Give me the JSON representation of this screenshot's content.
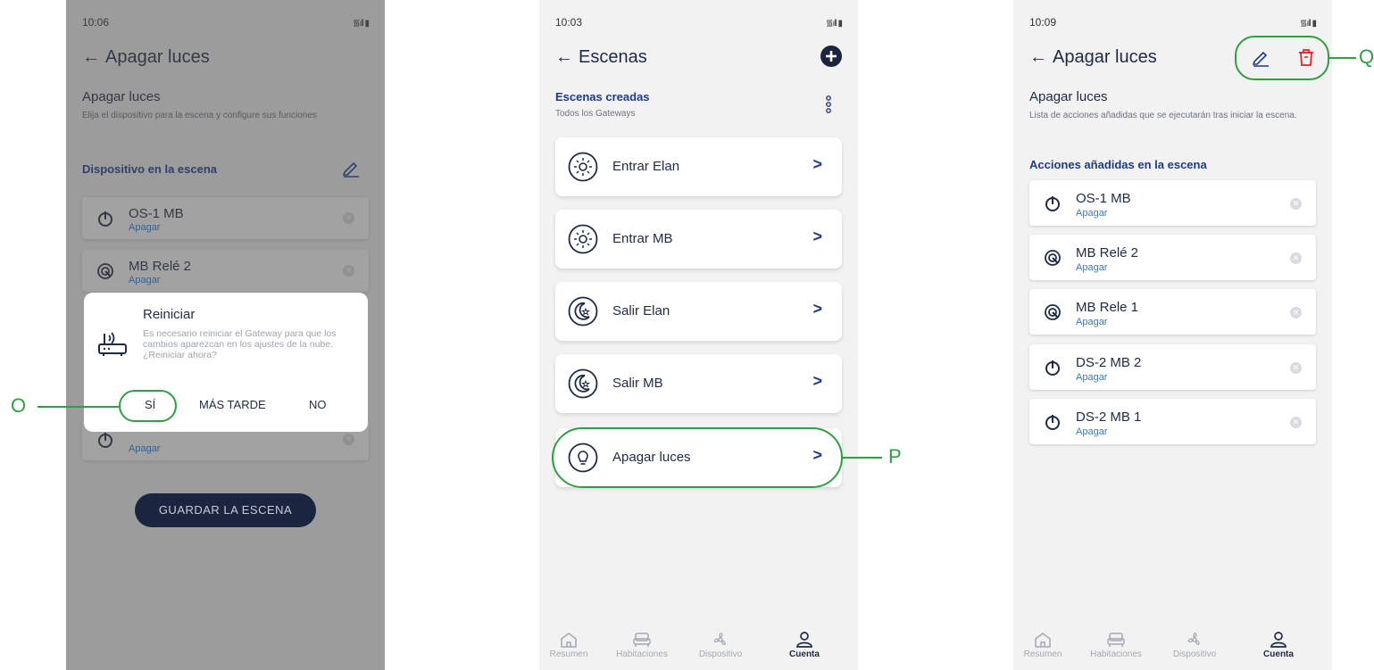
{
  "screen1": {
    "time": "10:06",
    "title": "Apagar luces",
    "section_title": "Apagar luces",
    "section_sub": "Elija el dispositivo para la escena y configure sus funciones",
    "devices_header": "Dispositivo en la escena",
    "devices": [
      {
        "name": "OS-1 MB",
        "action": "Apagar"
      },
      {
        "name": "MB Relé 2",
        "action": "Apagar"
      },
      {
        "name": "",
        "action": "Apagar"
      }
    ],
    "dialog": {
      "title": "Reiniciar",
      "body_1": "Es necesario reiniciar el Gateway para que los cambios aparezcan en los ajustes de la nube.",
      "body_2": "¿Reiniciar ahora?",
      "yes": "SÍ",
      "later": "MÁS TARDE",
      "no": "NO"
    },
    "save_button": "GUARDAR LA ESCENA"
  },
  "screen2": {
    "time": "10:03",
    "title": "Escenas",
    "section_title": "Escenas creadas",
    "section_sub": "Todos los Gateways",
    "scenes": [
      {
        "name": "Entrar Elan",
        "icon": "sun-icon"
      },
      {
        "name": "Entrar MB",
        "icon": "sun-icon"
      },
      {
        "name": "Salir Elan",
        "icon": "moon-star-icon"
      },
      {
        "name": "Salir MB",
        "icon": "moon-star-icon"
      },
      {
        "name": "Apagar luces",
        "icon": "bulb-icon"
      }
    ]
  },
  "screen3": {
    "time": "10:09",
    "title": "Apagar luces",
    "section_title": "Apagar luces",
    "section_sub": "Lista de acciones añadidas que se ejecutarán tras iniciar la escena.",
    "actions_header": "Acciones añadidas en la escena",
    "actions": [
      {
        "name": "OS-1 MB",
        "action": "Apagar",
        "icon": "power-icon"
      },
      {
        "name": "MB Relé 2",
        "action": "Apagar",
        "icon": "relay-icon"
      },
      {
        "name": "MB Rele 1",
        "action": "Apagar",
        "icon": "relay-icon"
      },
      {
        "name": "DS-2 MB 2",
        "action": "Apagar",
        "icon": "power-icon"
      },
      {
        "name": "DS-2 MB 1",
        "action": "Apagar",
        "icon": "power-icon"
      }
    ]
  },
  "tabs": [
    "Resumen",
    "Habitaciones",
    "Dispositivo",
    "Cuenta"
  ],
  "callouts": {
    "o": "O",
    "p": "P",
    "q": "Q"
  },
  "colors": {
    "accent_green": "#2ea043",
    "navy": "#1e3a8a",
    "link_blue": "#2b7bd6",
    "delete_red": "#e0262b"
  }
}
